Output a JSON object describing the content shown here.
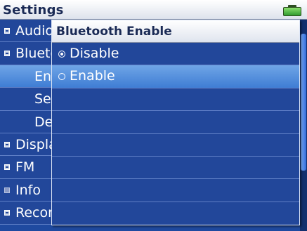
{
  "header": {
    "title": "Settings"
  },
  "status": {
    "battery_icon": "battery-full-icon"
  },
  "menu": {
    "items": [
      {
        "label": "Audio",
        "level": 1,
        "bullet": "collapsed"
      },
      {
        "label": "Bluetooth",
        "level": 1,
        "bullet": "expanded"
      },
      {
        "label": "Enable",
        "level": 2,
        "selected": true
      },
      {
        "label": "Search",
        "level": 2
      },
      {
        "label": "Devices",
        "level": 2
      },
      {
        "label": "Display",
        "level": 1,
        "bullet": "collapsed"
      },
      {
        "label": "FM",
        "level": 1,
        "bullet": "collapsed"
      },
      {
        "label": "Info",
        "level": 1,
        "bullet": "leaf"
      },
      {
        "label": "Recording",
        "level": 1,
        "bullet": "collapsed"
      }
    ]
  },
  "popup": {
    "title": "Bluetooth Enable",
    "options": [
      {
        "label": "Disable",
        "checked": true
      },
      {
        "label": "Enable",
        "checked": false,
        "highlighted": true
      }
    ]
  },
  "colors": {
    "panel": "#22479a",
    "highlight": "#4f8ddc",
    "header": "#ffffff"
  }
}
